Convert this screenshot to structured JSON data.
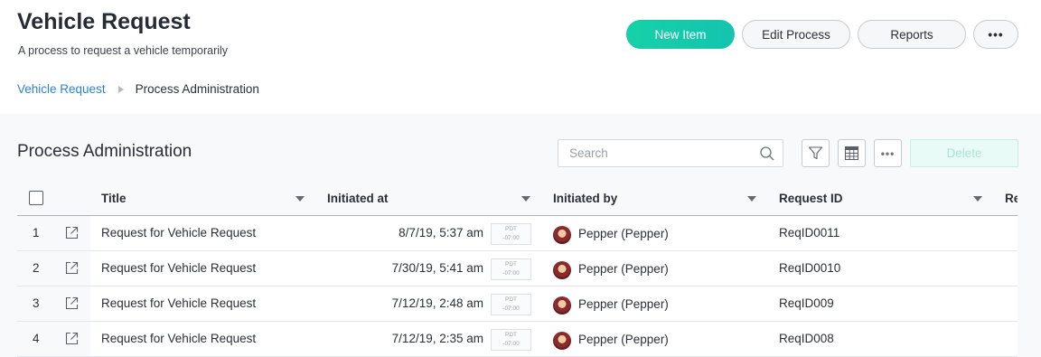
{
  "page": {
    "title": "Vehicle Request",
    "subtitle": "A process to request a vehicle temporarily"
  },
  "breadcrumb": {
    "link": "Vehicle Request",
    "current": "Process Administration"
  },
  "header_actions": {
    "new_item": "New Item",
    "edit_process": "Edit Process",
    "reports": "Reports",
    "more": "•••"
  },
  "panel": {
    "title": "Process Administration",
    "search_placeholder": "Search",
    "tools": {
      "filter": "filter-icon",
      "columns": "columns-icon",
      "more": "•••"
    },
    "delete_label": "Delete"
  },
  "table": {
    "columns": [
      "Title",
      "Initiated at",
      "Initiated by",
      "Request ID",
      "Re"
    ],
    "rows": [
      {
        "num": "1",
        "title": "Request for Vehicle Request",
        "initiated_at": "8/7/19, 5:37 am",
        "tz_name": "PDT",
        "tz_offset": "-07:00",
        "initiated_by": "Pepper (Pepper)",
        "request_id": "ReqID0011"
      },
      {
        "num": "2",
        "title": "Request for Vehicle Request",
        "initiated_at": "7/30/19, 5:41 am",
        "tz_name": "PDT",
        "tz_offset": "-07:00",
        "initiated_by": "Pepper (Pepper)",
        "request_id": "ReqID0010"
      },
      {
        "num": "3",
        "title": "Request for Vehicle Request",
        "initiated_at": "7/12/19, 2:48 am",
        "tz_name": "PDT",
        "tz_offset": "-07:00",
        "initiated_by": "Pepper (Pepper)",
        "request_id": "ReqID009"
      },
      {
        "num": "4",
        "title": "Request for Vehicle Request",
        "initiated_at": "7/12/19, 2:35 am",
        "tz_name": "PDT",
        "tz_offset": "-07:00",
        "initiated_by": "Pepper (Pepper)",
        "request_id": "ReqID008"
      }
    ]
  },
  "colors": {
    "accent": "#16d1a7",
    "link": "#2f80d6",
    "panel_bg": "#f8f9fb"
  }
}
